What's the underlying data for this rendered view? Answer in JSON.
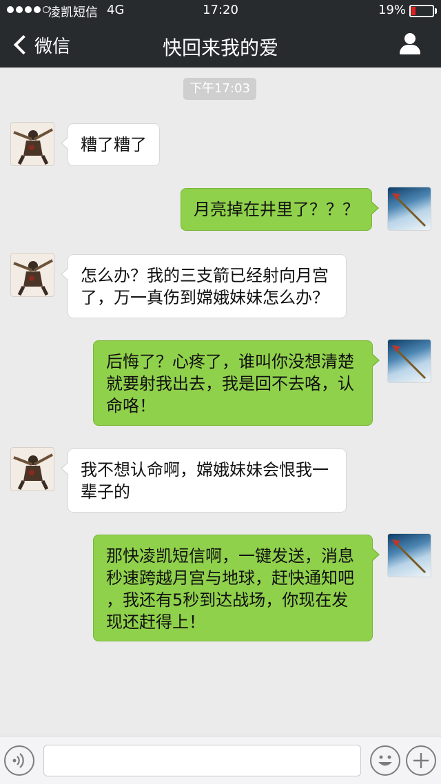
{
  "status_bar": {
    "carrier": "凌凯短信",
    "network": "4G",
    "time": "17:20",
    "battery_percent_text": "19%",
    "battery_level": 0.19,
    "signal_bars_filled": 4,
    "signal_bars_total": 5
  },
  "nav": {
    "back_label": "微信",
    "title": "快回来我的爱"
  },
  "timestamp": "下午17:03",
  "messages": [
    {
      "side": "in",
      "lines": [
        "糟了糟了"
      ]
    },
    {
      "side": "out",
      "lines": [
        "月亮掉在井里了？？？"
      ]
    },
    {
      "side": "in",
      "lines": [
        "怎么办？我的三支箭已经射向月宫",
        "了，万一真伤到嫦娥妹妹怎么办？"
      ]
    },
    {
      "side": "out",
      "lines": [
        "后悔了？心疼了，谁叫你没想清楚",
        "就要射我出去，我是回不去咯，认",
        "命咯！"
      ]
    },
    {
      "side": "in",
      "lines": [
        "我不想认命啊，嫦娥妹妹会恨我一",
        "辈子的"
      ]
    },
    {
      "side": "out",
      "lines": [
        "那快凌凯短信啊，一键发送，消息",
        "秒速跨越月宫与地球，赶快通知吧",
        "，我还有5秒到达战场，你现在发",
        "现还赶得上！"
      ]
    }
  ],
  "input": {
    "value": "",
    "placeholder": ""
  },
  "colors": {
    "topbar": "#272b2e",
    "background": "#ebebeb",
    "bubble_out": "#90d14b",
    "bubble_in": "#ffffff",
    "battery_low": "#e02020"
  },
  "icons": {
    "back": "chevron-left-icon",
    "profile": "user-icon",
    "voice": "voice-icon",
    "emoji": "emoji-icon",
    "more": "plus-icon"
  }
}
